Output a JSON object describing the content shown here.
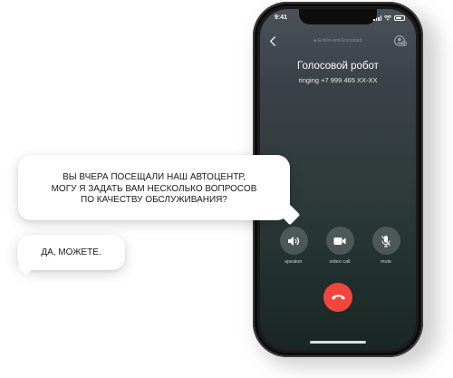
{
  "phone": {
    "status_bar": {
      "time": "9:41"
    },
    "header": {
      "encryption_notice": "End-to-end Encrypted"
    },
    "caller": {
      "name": "Голосовой робот",
      "status": "ringing +7 999 465 XX-XX"
    },
    "controls": [
      {
        "label": "speaker",
        "icon": "speaker-icon"
      },
      {
        "label": "video call",
        "icon": "video-camera-icon"
      },
      {
        "label": "mute",
        "icon": "microphone-mute-icon"
      }
    ],
    "end_call_icon": "phone-hangup-icon"
  },
  "bubbles": {
    "question": "ВЫ ВЧЕРА ПОСЕЩАЛИ НАШ АВТОЦЕНТР,\nМОГУ Я ЗАДАТЬ ВАМ НЕСКОЛЬКО ВОПРОСОВ\nПО КАЧЕСТВУ ОБСЛУЖИВАНИЯ?",
    "answer": "ДА, МОЖЕТЕ."
  },
  "colors": {
    "end_call": "#f0463c",
    "screen_top": "#4b5159",
    "screen_bottom": "#1a2624"
  }
}
